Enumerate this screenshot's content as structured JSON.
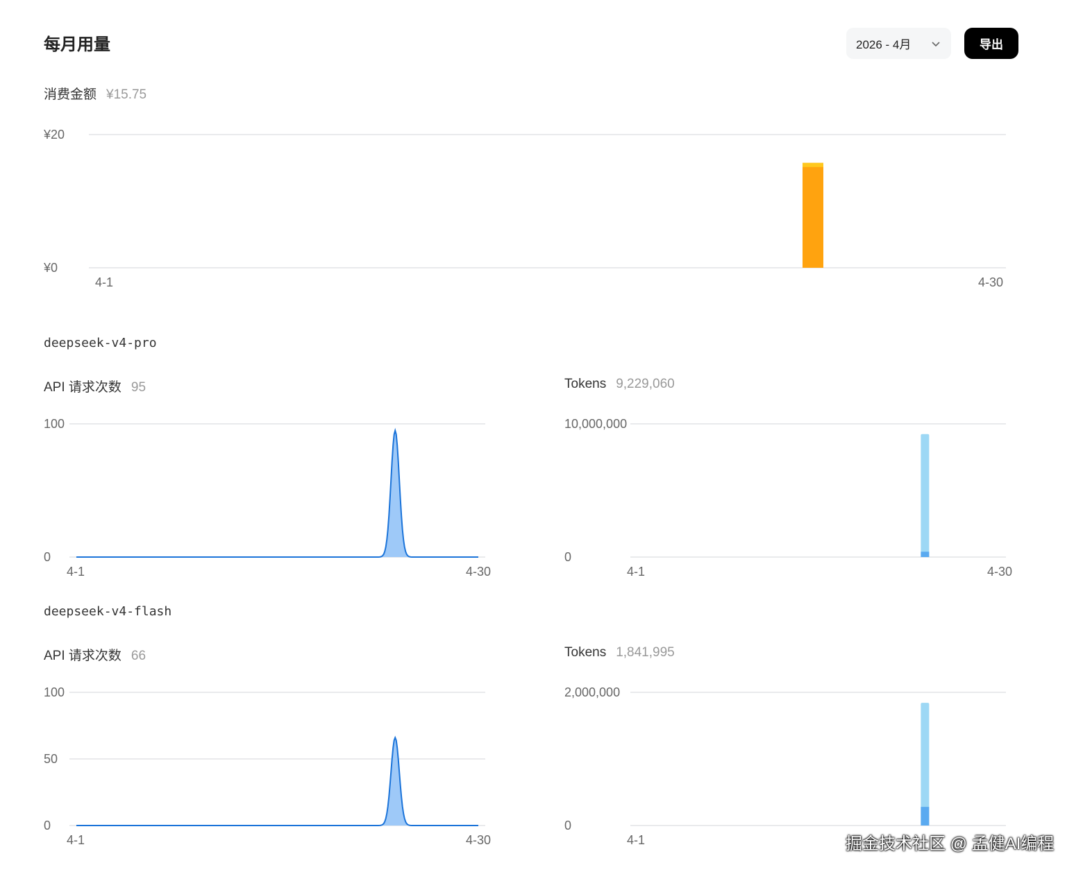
{
  "header": {
    "title": "每月用量",
    "month_value": "2026 - 4月",
    "export_label": "导出"
  },
  "cost": {
    "label": "消费金额",
    "value": "¥15.75"
  },
  "models": [
    {
      "name": "deepseek-v4-pro",
      "requests_label": "API 请求次数",
      "requests_value": "95",
      "tokens_label": "Tokens",
      "tokens_value": "9,229,060"
    },
    {
      "name": "deepseek-v4-flash",
      "requests_label": "API 请求次数",
      "requests_value": "66",
      "tokens_label": "Tokens",
      "tokens_value": "1,841,995"
    }
  ],
  "colors": {
    "cost_bar": "#ffa30f",
    "cost_bar_top": "#ffc81e",
    "request_line": "#1a73d9",
    "request_fill": "#9ec9f8",
    "token_bar": "#9dd8f5",
    "token_bar_dark": "#5aaaf0",
    "grid": "#dcdde0"
  },
  "chart_data": [
    {
      "type": "bar",
      "title": "消费金额",
      "xlabel": "",
      "ylabel": "",
      "x_tick_labels": [
        "4-1",
        "4-30"
      ],
      "y_tick_labels": [
        "¥0",
        "¥20"
      ],
      "x": [
        1,
        30
      ],
      "ylim": [
        0,
        20
      ],
      "series": [
        {
          "values": [
            {
              "x": 24,
              "y": 15.75
            }
          ]
        }
      ]
    },
    {
      "type": "area",
      "title": "API 请求次数",
      "xlabel": "",
      "ylabel": "",
      "x_tick_labels": [
        "4-1",
        "4-30"
      ],
      "y_tick_labels": [
        "0",
        "100"
      ],
      "x": [
        1,
        30
      ],
      "ylim": [
        0,
        100
      ],
      "series": [
        {
          "peak_x": 24,
          "peak_y": 95
        }
      ]
    },
    {
      "type": "bar",
      "title": "Tokens",
      "xlabel": "",
      "ylabel": "",
      "x_tick_labels": [
        "4-1",
        "4-30"
      ],
      "y_tick_labels": [
        "0",
        "10,000,000"
      ],
      "x": [
        1,
        30
      ],
      "ylim": [
        0,
        10000000
      ],
      "series": [
        {
          "values": [
            {
              "x": 24,
              "y": 9229060,
              "lower": 400000
            }
          ]
        }
      ]
    },
    {
      "type": "area",
      "title": "API 请求次数",
      "xlabel": "",
      "ylabel": "",
      "x_tick_labels": [
        "4-1",
        "4-30"
      ],
      "y_tick_labels": [
        "0",
        "50",
        "100"
      ],
      "x": [
        1,
        30
      ],
      "ylim": [
        0,
        100
      ],
      "series": [
        {
          "peak_x": 24,
          "peak_y": 66
        }
      ]
    },
    {
      "type": "bar",
      "title": "Tokens",
      "xlabel": "",
      "ylabel": "",
      "x_tick_labels": [
        "4-1"
      ],
      "y_tick_labels": [
        "0",
        "2,000,000"
      ],
      "x": [
        1,
        30
      ],
      "ylim": [
        0,
        2000000
      ],
      "series": [
        {
          "values": [
            {
              "x": 24,
              "y": 1841995,
              "lower": 280000
            }
          ]
        }
      ]
    }
  ],
  "watermark": "掘金技术社区 @ 孟健AI编程"
}
